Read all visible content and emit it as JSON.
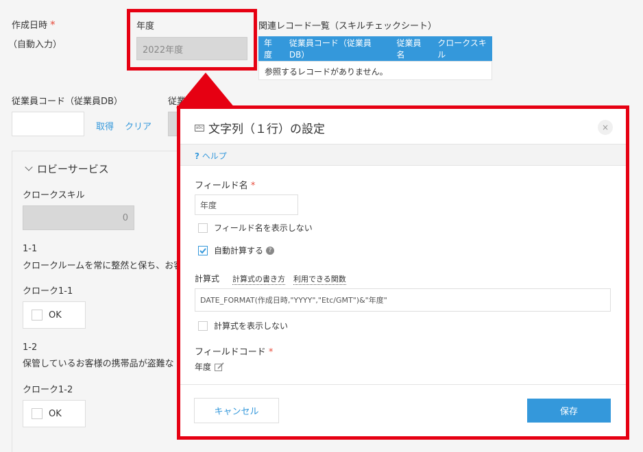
{
  "form": {
    "created_label": "作成日時",
    "created_req": "*",
    "created_note": "（自動入力）",
    "year_label": "年度",
    "year_value": "2022年度",
    "related_title": "関連レコード一覧（スキルチェックシート）",
    "related_headers": [
      "年度",
      "従業員コード（従業員DB）",
      "従業員名",
      "クロークスキル"
    ],
    "related_empty": "参照するレコードがありません。",
    "emp_code_label": "従業員コード（従業員DB）",
    "emp_partial_label": "従業員",
    "fetch_link": "取得",
    "clear_link": "クリア",
    "group_title": "ロビーサービス",
    "clock_skill_label": "クロークスキル",
    "clock_skill_value": "0",
    "item1_no": "1-1",
    "item1_text": "クロークルームを常に整然と保ち、お客",
    "clock1_label": "クローク1-1",
    "ok1": "OK",
    "item2_no": "1-2",
    "item2_text": "保管しているお客様の携帯品が盗難な",
    "clock2_label": "クローク1-2",
    "ok2": "OK"
  },
  "dialog": {
    "title": "文字列（１行）の設定",
    "title_icon": "text-field-icon",
    "close": "×",
    "help_mark": "?",
    "help": "ヘルプ",
    "field_name_label": "フィールド名",
    "req": "*",
    "field_name_value": "年度",
    "hide_field_name": "フィールド名を表示しない",
    "auto_calc": "自動計算する",
    "formula_label": "計算式",
    "formula_howto": "計算式の書き方",
    "formula_functions": "利用できる関数",
    "formula_value": "DATE_FORMAT(作成日時,\"YYYY\",\"Etc/GMT\")&\"年度\"",
    "hide_formula": "計算式を表示しない",
    "field_code_label": "フィールドコード",
    "field_code_value": "年度",
    "cancel": "キャンセル",
    "save": "保存"
  },
  "colors": {
    "accent": "#3498db",
    "highlight": "#e60012",
    "required": "#e74c3c"
  }
}
